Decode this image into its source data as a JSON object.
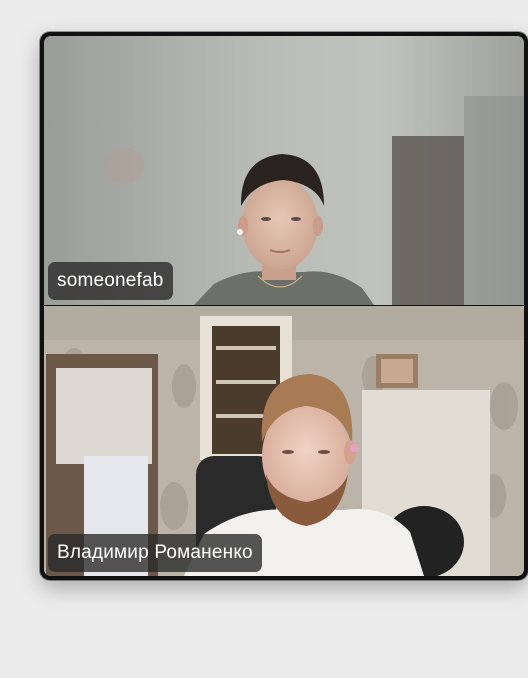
{
  "participants": [
    {
      "name": "someonefab"
    },
    {
      "name": "Владимир Романенко"
    }
  ]
}
